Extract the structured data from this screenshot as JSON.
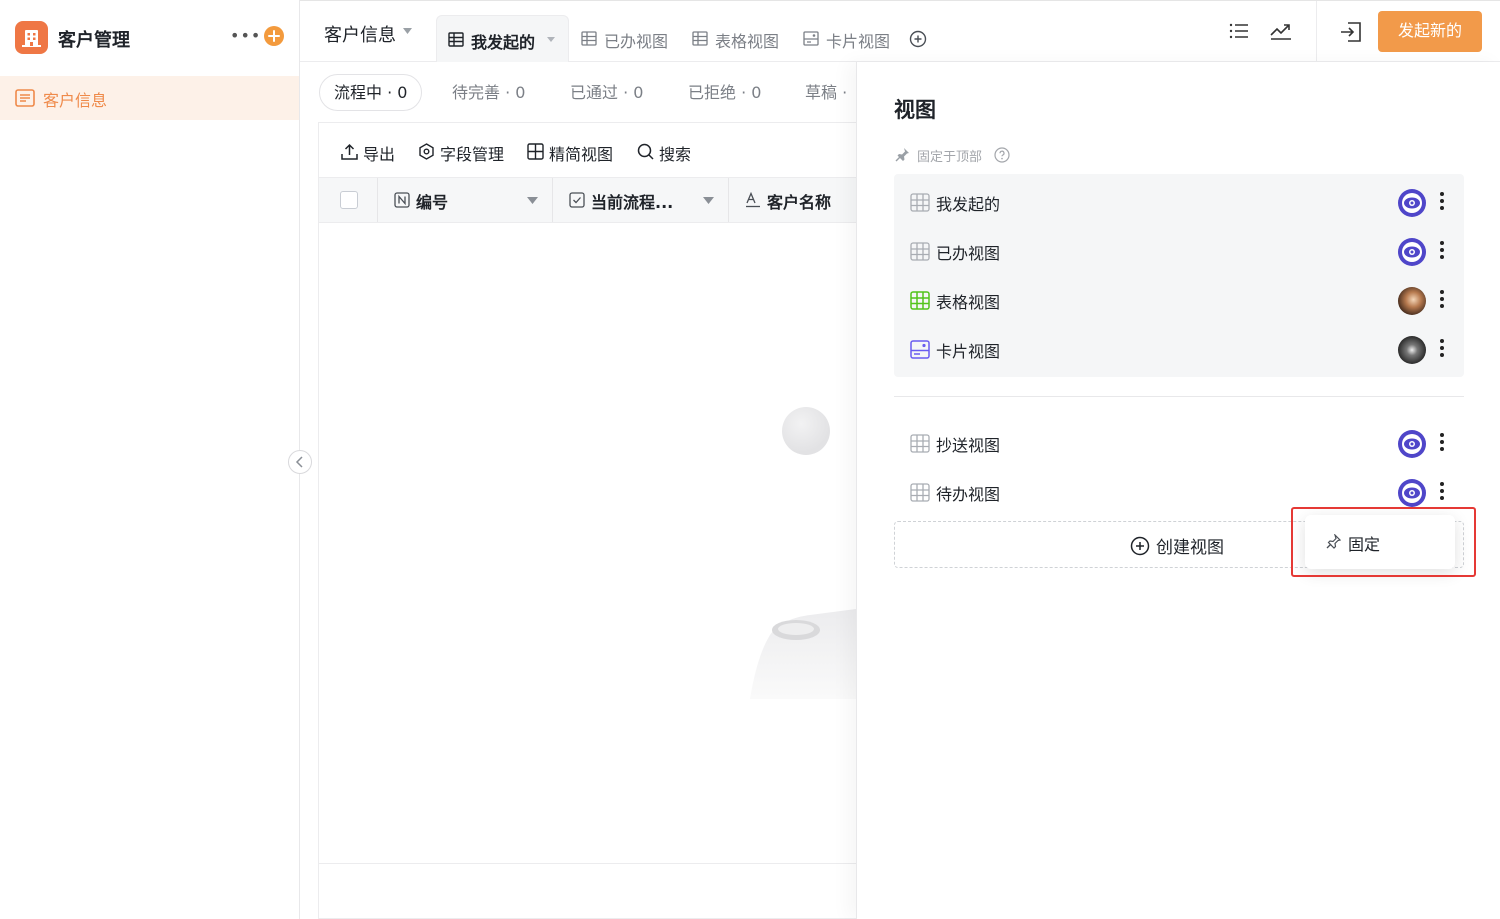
{
  "sidebar": {
    "app_title": "客户管理",
    "more_icon": "more-icon",
    "items": [
      {
        "label": "客户信息",
        "icon": "form-icon",
        "active": true
      }
    ]
  },
  "topbar": {
    "page_title": "客户信息",
    "tabs": [
      {
        "label": "我发起的",
        "icon": "table-icon",
        "active": true
      },
      {
        "label": "已办视图",
        "icon": "table-icon"
      },
      {
        "label": "表格视图",
        "icon": "table-icon"
      },
      {
        "label": "卡片视图",
        "icon": "card-icon"
      }
    ],
    "primary_button": "发起新的"
  },
  "filters": [
    {
      "label": "流程中",
      "count": "0",
      "active": true
    },
    {
      "label": "待完善",
      "count": "0"
    },
    {
      "label": "已通过",
      "count": "0"
    },
    {
      "label": "已拒绝",
      "count": "0"
    },
    {
      "label": "草稿",
      "count": ""
    }
  ],
  "toolbar": {
    "export": "导出",
    "fields": "字段管理",
    "simple_view": "精简视图",
    "search": "搜索"
  },
  "table": {
    "columns": [
      {
        "label": "编号",
        "icon": "number-field-icon"
      },
      {
        "label": "当前流程...",
        "icon": "checkbox-field-icon"
      },
      {
        "label": "客户名称",
        "icon": "text-field-icon"
      }
    ]
  },
  "view_panel": {
    "title": "视图",
    "pin_hint": "固定于顶部",
    "pinned": [
      {
        "label": "我发起的",
        "icon": "table-icon",
        "avatar": "eye-avatar"
      },
      {
        "label": "已办视图",
        "icon": "table-icon",
        "avatar": "eye-avatar"
      },
      {
        "label": "表格视图",
        "icon": "table-icon-green",
        "avatar": "photo-avatar-brown"
      },
      {
        "label": "卡片视图",
        "icon": "card-icon-purple",
        "avatar": "photo-avatar-dark"
      }
    ],
    "unpinned": [
      {
        "label": "抄送视图",
        "icon": "table-icon",
        "avatar": "eye-avatar"
      },
      {
        "label": "待办视图",
        "icon": "table-icon",
        "avatar": "eye-avatar"
      }
    ],
    "create_label": "创建视图"
  },
  "dropdown": {
    "items": [
      {
        "label": "固定",
        "icon": "pin-icon"
      }
    ]
  },
  "colors": {
    "brand": "#ef7745",
    "primary_button": "#f29a4a",
    "active_sidebar_bg": "#fdf1e8",
    "highlight": "#e53935",
    "avatar_eye": "#4f46c9"
  }
}
